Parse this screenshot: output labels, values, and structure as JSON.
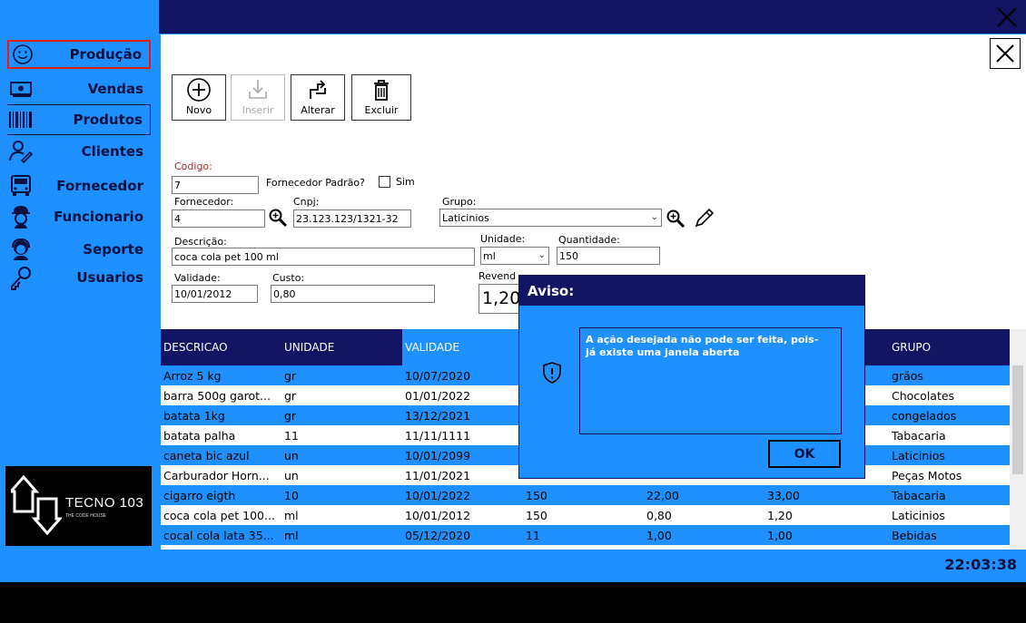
{
  "sidebar": {
    "items": [
      {
        "label": "Produção",
        "icon": "smiley-icon"
      },
      {
        "label": "Vendas",
        "icon": "cash-icon"
      },
      {
        "label": "Produtos",
        "icon": "barcode-icon"
      },
      {
        "label": "Clientes",
        "icon": "user-edit-icon"
      },
      {
        "label": "Fornecedor",
        "icon": "truck-icon"
      },
      {
        "label": "Funcionario",
        "icon": "worker-icon"
      },
      {
        "label": "Seporte",
        "icon": "headset-icon"
      },
      {
        "label": "Usuarios",
        "icon": "key-icon"
      }
    ],
    "logo": {
      "name": "TECNO 103",
      "tagline": "THE CODE HOUSE"
    }
  },
  "clock": "22:03:38",
  "toolbar": {
    "novo": "Novo",
    "inserir": "Inserir",
    "alterar": "Alterar",
    "excluir": "Excluir"
  },
  "form": {
    "codigo_label": "Codigo:",
    "codigo": "7",
    "fornecedor_padrao_label": "Fornecedor Padrão?",
    "sim_label": "Sim",
    "fornecedor_label": "Fornecedor:",
    "fornecedor": "4",
    "cnpj_label": "Cnpj:",
    "cnpj": "23.123.123/1321-32",
    "grupo_label": "Grupo:",
    "grupo": "Laticinios",
    "descricao_label": "Descrição:",
    "descricao": "coca cola pet 100 ml",
    "unidade_label": "Unidade:",
    "unidade": "ml",
    "quantidade_label": "Quantidade:",
    "quantidade": "150",
    "validade_label": "Validade:",
    "validade": "10/01/2012",
    "custo_label": "Custo:",
    "custo": "0,80",
    "revenda_label": "Revend",
    "revenda": "1,20"
  },
  "grid": {
    "headers": [
      "DESCRICAO",
      "UNIDADE",
      "VALIDADE",
      "",
      "",
      "",
      "GRUPO"
    ],
    "rows": [
      [
        "Arroz 5 kg",
        "gr",
        "10/07/2020",
        "",
        "",
        "",
        "grãos"
      ],
      [
        "barra 500g garot...",
        "gr",
        "01/01/2022",
        "",
        "",
        "",
        "Chocolates"
      ],
      [
        "batata 1kg",
        "gr",
        "13/12/2021",
        "",
        "",
        "",
        "congelados"
      ],
      [
        "batata palha",
        "11",
        "11/11/1111",
        "",
        "",
        "",
        "Tabacaria"
      ],
      [
        "caneta bic azul",
        "un",
        "10/01/2099",
        "",
        "",
        "",
        "Laticinios"
      ],
      [
        "Carburador Horn...",
        "un",
        "11/01/2021",
        "",
        "",
        "",
        "Peças Motos"
      ],
      [
        "cigarro eigth",
        "10",
        "10/01/2022",
        "150",
        "22,00",
        "33,00",
        "Tabacaria"
      ],
      [
        "coca cola pet 100...",
        "ml",
        "10/01/2012",
        "150",
        "0,80",
        "1,20",
        "Laticinios"
      ],
      [
        "cocal cola lata 35...",
        "ml",
        "05/12/2020",
        "11",
        "1,00",
        "1,00",
        "Bebidas"
      ]
    ]
  },
  "dialog": {
    "title": "Aviso:",
    "message_line1": "A ação desejada não pode ser feita, pois-",
    "message_line2": "já existe uma janela aberta",
    "ok": "OK"
  },
  "colors": {
    "primary": "#1e90ff",
    "dark": "#141464",
    "active_border": "#e01b1b"
  }
}
